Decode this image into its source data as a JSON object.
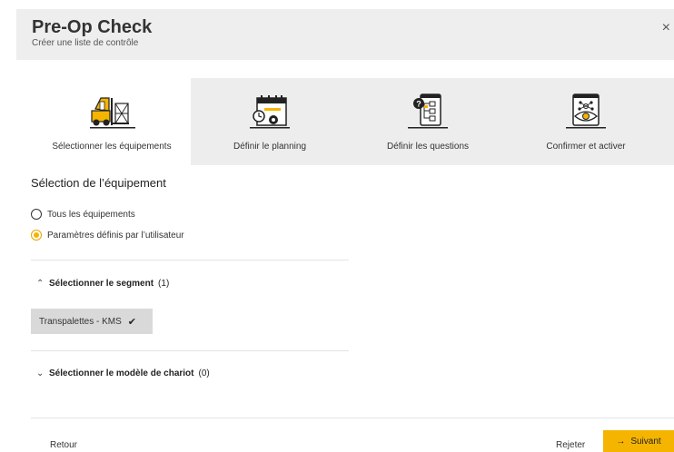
{
  "header": {
    "title": "Pre-Op Check",
    "subtitle": "Créer une liste de contrôle",
    "close_glyph": "×"
  },
  "steps": [
    {
      "label": "Sélectionner les équipements",
      "icon": "forklift-icon",
      "active": true
    },
    {
      "label": "Définir le planning",
      "icon": "calendar-gear-icon",
      "active": false
    },
    {
      "label": "Définir les questions",
      "icon": "question-checklist-icon",
      "active": false
    },
    {
      "label": "Confirmer et activer",
      "icon": "eye-network-icon",
      "active": false
    }
  ],
  "main": {
    "section_title": "Sélection de l’équipement",
    "radio_all": "Tous les équipements",
    "radio_custom": "Paramètres définis par l’utilisateur",
    "segment_title": "Sélectionner le segment",
    "segment_count": "(1)",
    "segment_chip": "Transpalettes - KMS",
    "model_title": "Sélectionner le modèle de chariot",
    "model_count": "(0)"
  },
  "footer": {
    "back_label": "Retour",
    "reject_label": "Rejeter",
    "next_label": "Suivant",
    "next_arrow": "→"
  },
  "colors": {
    "accent": "#f5b400",
    "header_bg": "#eeeeee",
    "steps_bg": "#ededed"
  }
}
